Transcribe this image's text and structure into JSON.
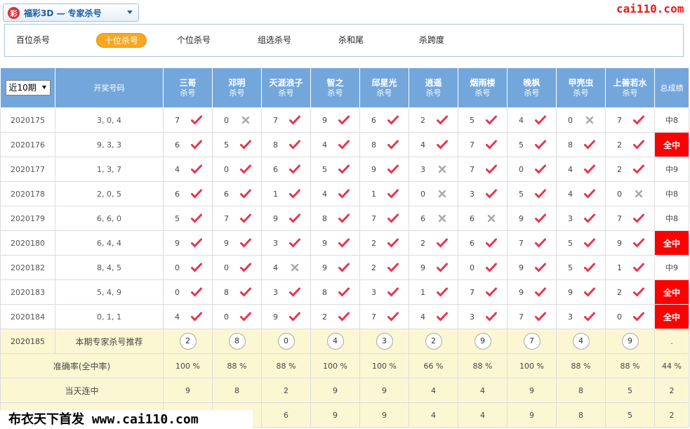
{
  "header": {
    "lottery_title": "福彩3D — 专家杀号",
    "site_logo": "cai110.com"
  },
  "tabs": [
    {
      "label": "百位杀号",
      "active": false
    },
    {
      "label": "十位杀号",
      "active": true
    },
    {
      "label": "个位杀号",
      "active": false
    },
    {
      "label": "组选杀号",
      "active": false
    },
    {
      "label": "杀和尾",
      "active": false
    },
    {
      "label": "杀跨度",
      "active": false
    }
  ],
  "table": {
    "period_select": "近10期",
    "col_draw": "开奖号码",
    "col_total": "总成绩",
    "sub_label": "杀号",
    "experts": [
      "三哥",
      "邓明",
      "天涯浪子",
      "智之",
      "邱星光",
      "逍遥",
      "烟雨楼",
      "晚枫",
      "甲壳虫",
      "上善若水"
    ],
    "rows": [
      {
        "issue": "2020175",
        "draw": "3, 0, 4",
        "kills": [
          [
            "7",
            1
          ],
          [
            "0",
            0
          ],
          [
            "7",
            1
          ],
          [
            "9",
            1
          ],
          [
            "6",
            1
          ],
          [
            "2",
            1
          ],
          [
            "5",
            1
          ],
          [
            "4",
            1
          ],
          [
            "0",
            0
          ],
          [
            "7",
            1
          ]
        ],
        "total": "中8",
        "full": false
      },
      {
        "issue": "2020176",
        "draw": "9, 3, 3",
        "kills": [
          [
            "6",
            1
          ],
          [
            "5",
            1
          ],
          [
            "8",
            1
          ],
          [
            "4",
            1
          ],
          [
            "8",
            1
          ],
          [
            "4",
            1
          ],
          [
            "7",
            1
          ],
          [
            "5",
            1
          ],
          [
            "8",
            1
          ],
          [
            "2",
            1
          ]
        ],
        "total": "全中",
        "full": true
      },
      {
        "issue": "2020177",
        "draw": "1, 3, 7",
        "kills": [
          [
            "4",
            1
          ],
          [
            "0",
            1
          ],
          [
            "6",
            1
          ],
          [
            "5",
            1
          ],
          [
            "9",
            1
          ],
          [
            "3",
            0
          ],
          [
            "7",
            1
          ],
          [
            "0",
            1
          ],
          [
            "4",
            1
          ],
          [
            "2",
            1
          ]
        ],
        "total": "中9",
        "full": false
      },
      {
        "issue": "2020178",
        "draw": "2, 0, 5",
        "kills": [
          [
            "6",
            1
          ],
          [
            "6",
            1
          ],
          [
            "1",
            1
          ],
          [
            "4",
            1
          ],
          [
            "1",
            1
          ],
          [
            "0",
            0
          ],
          [
            "3",
            1
          ],
          [
            "5",
            1
          ],
          [
            "4",
            1
          ],
          [
            "0",
            0
          ]
        ],
        "total": "中8",
        "full": false
      },
      {
        "issue": "2020179",
        "draw": "6, 6, 0",
        "kills": [
          [
            "5",
            1
          ],
          [
            "7",
            1
          ],
          [
            "9",
            1
          ],
          [
            "8",
            1
          ],
          [
            "7",
            1
          ],
          [
            "6",
            0
          ],
          [
            "6",
            0
          ],
          [
            "9",
            1
          ],
          [
            "3",
            1
          ],
          [
            "7",
            1
          ]
        ],
        "total": "中8",
        "full": false
      },
      {
        "issue": "2020180",
        "draw": "6, 4, 4",
        "kills": [
          [
            "9",
            1
          ],
          [
            "9",
            1
          ],
          [
            "3",
            1
          ],
          [
            "9",
            1
          ],
          [
            "2",
            1
          ],
          [
            "2",
            1
          ],
          [
            "6",
            1
          ],
          [
            "7",
            1
          ],
          [
            "5",
            1
          ],
          [
            "9",
            1
          ]
        ],
        "total": "全中",
        "full": true
      },
      {
        "issue": "2020182",
        "draw": "8, 4, 5",
        "kills": [
          [
            "0",
            1
          ],
          [
            "0",
            1
          ],
          [
            "4",
            0
          ],
          [
            "9",
            1
          ],
          [
            "2",
            1
          ],
          [
            "9",
            1
          ],
          [
            "0",
            1
          ],
          [
            "9",
            1
          ],
          [
            "5",
            1
          ],
          [
            "1",
            1
          ]
        ],
        "total": "中9",
        "full": false
      },
      {
        "issue": "2020183",
        "draw": "5, 4, 9",
        "kills": [
          [
            "0",
            1
          ],
          [
            "8",
            1
          ],
          [
            "3",
            1
          ],
          [
            "8",
            1
          ],
          [
            "3",
            1
          ],
          [
            "1",
            1
          ],
          [
            "7",
            1
          ],
          [
            "9",
            1
          ],
          [
            "9",
            1
          ],
          [
            "2",
            1
          ]
        ],
        "total": "全中",
        "full": true
      },
      {
        "issue": "2020184",
        "draw": "0, 1, 1",
        "kills": [
          [
            "4",
            1
          ],
          [
            "0",
            1
          ],
          [
            "9",
            1
          ],
          [
            "2",
            1
          ],
          [
            "7",
            1
          ],
          [
            "4",
            1
          ],
          [
            "3",
            1
          ],
          [
            "7",
            1
          ],
          [
            "3",
            1
          ],
          [
            "0",
            1
          ]
        ],
        "total": "全中",
        "full": true
      }
    ],
    "recommend": {
      "issue": "2020185",
      "label": "本期专家杀号推荐",
      "balls": [
        "2",
        "8",
        "0",
        "4",
        "3",
        "2",
        "9",
        "7",
        "4",
        "9"
      ],
      "total": "."
    },
    "accuracy": {
      "label": "准确率(全中率)",
      "values": [
        "100 %",
        "88 %",
        "88 %",
        "100 %",
        "100 %",
        "66 %",
        "88 %",
        "100 %",
        "88 %",
        "88 %"
      ],
      "total": "44 %"
    },
    "streak": {
      "label": "当天连中",
      "values": [
        "9",
        "8",
        "2",
        "9",
        "9",
        "4",
        "4",
        "9",
        "8",
        "5"
      ],
      "total": "2"
    },
    "last_row": {
      "values": [
        "6",
        "9",
        "9",
        "4",
        "4",
        "9",
        "8",
        "5"
      ],
      "total": "2"
    }
  },
  "colors": {
    "header_blue": "#73a7dc",
    "hit_red": "#e8344e",
    "miss_gray": "#a8a8a8",
    "full_red": "#ff0000",
    "tab_orange": "#f7a722"
  },
  "footer": {
    "watermark": "布衣天下首发 www.cai110.com"
  }
}
